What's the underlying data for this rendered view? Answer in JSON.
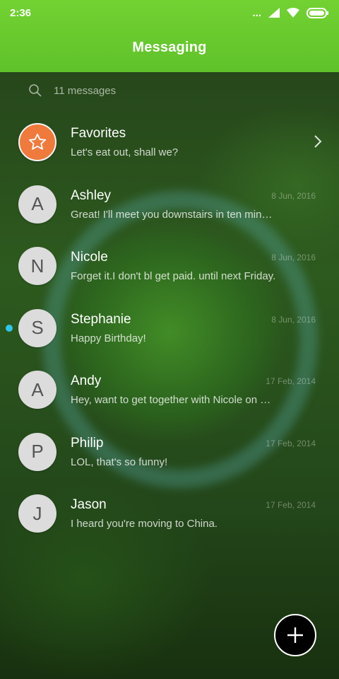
{
  "status_bar": {
    "time": "2:36",
    "dots": "..."
  },
  "header": {
    "title": "Messaging"
  },
  "search": {
    "count_text": "11 messages"
  },
  "conversations": [
    {
      "name": "Favorites",
      "preview": "Let's eat out, shall we?",
      "date": "",
      "avatar": "star-icon"
    },
    {
      "name": "Ashley",
      "preview": "Great! I'll meet you downstairs in ten minutes.",
      "date": "8 Jun, 2016",
      "avatar": "A"
    },
    {
      "name": "Nicole",
      "preview": "Forget it.I don't bl get paid. until next Friday.",
      "date": "8 Jun, 2016",
      "avatar": "N"
    },
    {
      "name": "Stephanie",
      "preview": "Happy Birthday!",
      "date": "8 Jun, 2016",
      "avatar": "S",
      "unread": true
    },
    {
      "name": "Andy",
      "preview": "Hey, want to get together with Nicole on Saturday?",
      "date": "17 Feb, 2014",
      "avatar": "A"
    },
    {
      "name": "Philip",
      "preview": "LOL, that's so funny!",
      "date": "17 Feb, 2014",
      "avatar": "P"
    },
    {
      "name": "Jason",
      "preview": "I heard you're moving to China.",
      "date": "17 Feb, 2014",
      "avatar": "J"
    }
  ],
  "colors": {
    "header": "#6ccc2e",
    "favorites_avatar": "#f07a3c",
    "unread_dot": "#2ec6ec"
  }
}
